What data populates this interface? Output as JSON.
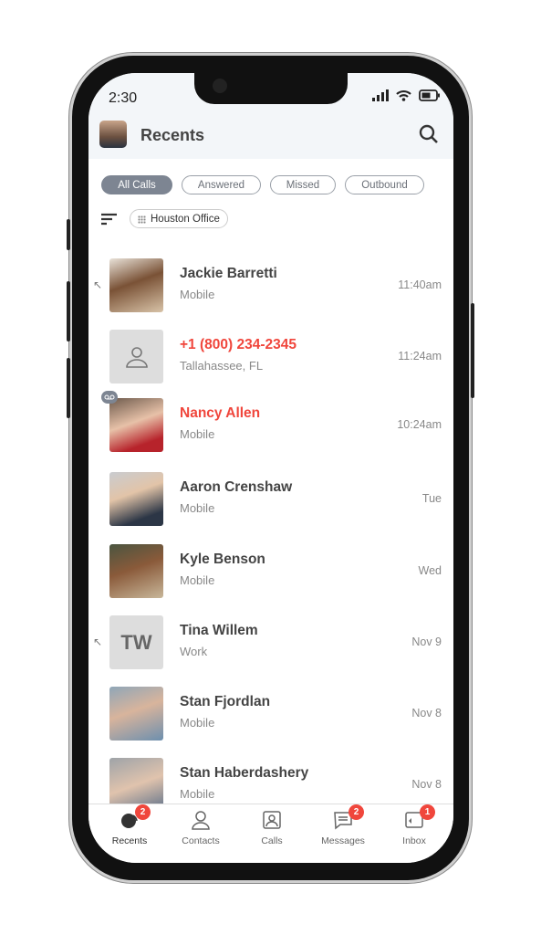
{
  "status": {
    "time": "2:30"
  },
  "header": {
    "title": "Recents"
  },
  "filters": [
    {
      "label": "All Calls",
      "active": true
    },
    {
      "label": "Answered"
    },
    {
      "label": "Missed"
    },
    {
      "label": "Outbound"
    }
  ],
  "office": "Houston Office",
  "calls": [
    {
      "name": "Jackie Barretti",
      "sub": "Mobile",
      "time": "11:40am",
      "missed": false,
      "outbound": true,
      "avatar": "photo"
    },
    {
      "name": "+1 (800) 234-2345",
      "sub": "Tallahassee, FL",
      "time": "11:24am",
      "missed": true,
      "avatar": "placeholder"
    },
    {
      "name": "Nancy Allen",
      "sub": "Mobile",
      "time": "10:24am",
      "missed": true,
      "voicemail": true,
      "avatar": "photo"
    },
    {
      "name": "Aaron Crenshaw",
      "sub": "Mobile",
      "time": "Tue",
      "avatar": "photo"
    },
    {
      "name": "Kyle Benson",
      "sub": "Mobile",
      "time": "Wed",
      "avatar": "photo"
    },
    {
      "name": "Tina Willem",
      "sub": "Work",
      "time": "Nov 9",
      "outbound": true,
      "avatar": "initials",
      "initials": "TW"
    },
    {
      "name": "Stan Fjordlan",
      "sub": "Mobile",
      "time": "Nov 8",
      "avatar": "photo"
    },
    {
      "name": "Stan Haberdashery",
      "sub": "Mobile",
      "time": "Nov 8",
      "avatar": "photo"
    }
  ],
  "tabs": [
    {
      "label": "Recents",
      "badge": "2",
      "active": true
    },
    {
      "label": "Contacts"
    },
    {
      "label": "Calls"
    },
    {
      "label": "Messages",
      "badge": "2"
    },
    {
      "label": "Inbox",
      "badge": "1"
    }
  ],
  "colors": {
    "missed": "#f0463c",
    "chip_active": "#7d8592",
    "badge": "#f0463c"
  }
}
